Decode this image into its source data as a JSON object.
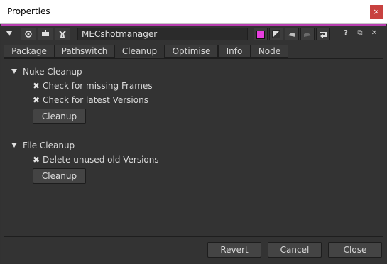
{
  "window": {
    "title": "Properties",
    "close_glyph": "×"
  },
  "accent_color": "#b83fb0",
  "toolbar": {
    "node_name": "MECshotmanager",
    "icons": [
      "collapse-triangle-icon",
      "viewer-icon",
      "grab-icon",
      "wrench-icon",
      "color-swatch-icon",
      "checker-icon",
      "undo-icon",
      "redo-icon",
      "revert-icon",
      "help-icon",
      "float-icon",
      "close-icon"
    ],
    "help_glyph": "?",
    "float_glyph": "⧉",
    "close_glyph": "✕"
  },
  "tabs": [
    "Package",
    "Pathswitch",
    "Cleanup",
    "Optimise",
    "Info",
    "Node"
  ],
  "active_tab": "Cleanup",
  "sections": {
    "nuke": {
      "title": "Nuke Cleanup",
      "checks": [
        "Check for missing Frames",
        "Check for latest Versions"
      ],
      "button": "Cleanup"
    },
    "file": {
      "title": "File Cleanup",
      "checks": [
        "Delete unused old Versions"
      ],
      "button": "Cleanup"
    }
  },
  "check_glyph": "✖",
  "footer": {
    "revert": "Revert",
    "cancel": "Cancel",
    "close": "Close"
  }
}
